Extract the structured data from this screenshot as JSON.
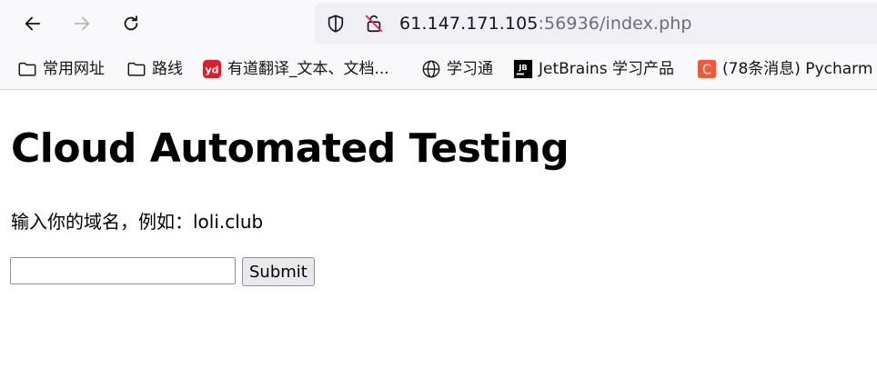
{
  "browser": {
    "url_host": "61.147.171.105",
    "url_rest": ":56936/index.php",
    "bookmarks": [
      {
        "label": "常用网址",
        "icon": "folder-icon"
      },
      {
        "label": "路线",
        "icon": "folder-icon"
      },
      {
        "label": "有道翻译_文本、文档...",
        "icon": "youdao-logo-icon",
        "badge": "yd",
        "color": "#e21b2c"
      },
      {
        "label": "学习通",
        "icon": "globe-icon"
      },
      {
        "label": "JetBrains 学习产品",
        "icon": "jetbrains-logo-icon",
        "badge": "JB",
        "color": "#000000"
      },
      {
        "label": "(78条消息) Pycharm",
        "icon": "csdn-logo-icon",
        "badge": "C",
        "color": "#fc5531"
      }
    ]
  },
  "page": {
    "title": "Cloud Automated Testing",
    "prompt": "输入你的域名，例如：loli.club",
    "input_value": "",
    "submit_label": "Submit"
  }
}
